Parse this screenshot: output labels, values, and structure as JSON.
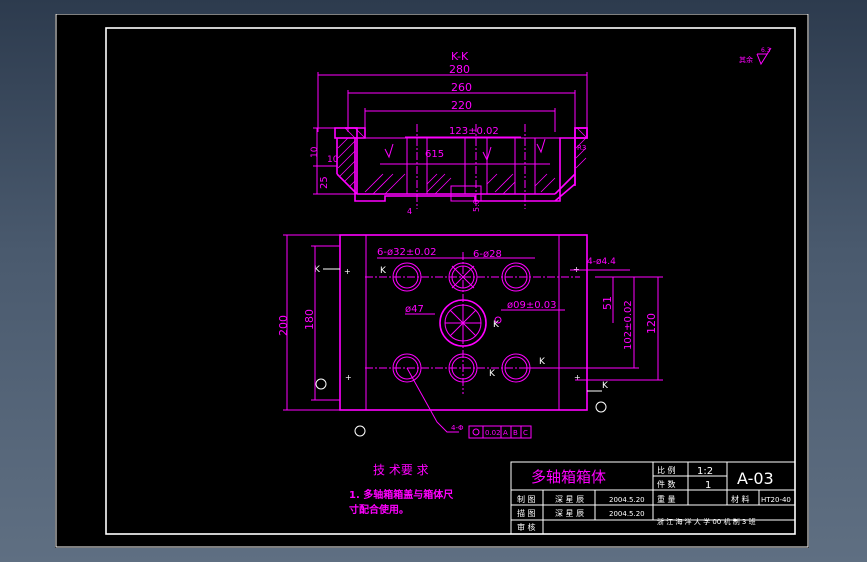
{
  "section": {
    "title": "K-K",
    "dims": {
      "overall": "280",
      "mid": "260",
      "inner": "220",
      "bore_pitch": "123±0.02",
      "t10a": "10",
      "t10b": "10",
      "t25": "25",
      "d615": "615",
      "d4": "4",
      "d56": "5.6",
      "r3": "R3"
    }
  },
  "plan": {
    "holes_large": "6-ø32±0.02",
    "holes_small": "6-ø28",
    "bolt_holes": "4-ø4.4",
    "center_hole": "ø47",
    "center_bore": "ø09±0.03",
    "height_overall": "200",
    "height_inner": "180",
    "right_dim_51": "51",
    "right_dim_102": "102±0.02",
    "right_dim_120": "120",
    "section_mark": "K",
    "tolerance_frame": [
      "4-Φ",
      "",
      "0.02",
      "A",
      "B",
      "C"
    ]
  },
  "tech_req": {
    "heading": "技 术要 求",
    "line1": "1. 多轴箱箱盖与箱体尺",
    "line2": "寸配合使用。"
  },
  "roughness": {
    "label": "其余",
    "value": "6.3"
  },
  "title_block": {
    "part_name": "多轴箱箱体",
    "ratio_label": "比 例",
    "ratio_value": "1:2",
    "qty_label": "件 数",
    "qty_value": "1",
    "drawing_no": "A-03",
    "weight_label": "重 量",
    "material_label": "材 料",
    "material_value": "HT20-40",
    "row1_label": "制 图",
    "row1_name": "深 星 辰",
    "row1_date": "2004.5.20",
    "row2_label": "描 图",
    "row2_name": "深 星 辰",
    "row2_date": "2004.5.20",
    "row3_label": "审 核",
    "org": "浙 江 海 洋 大 学 00 机 制 3 班"
  }
}
